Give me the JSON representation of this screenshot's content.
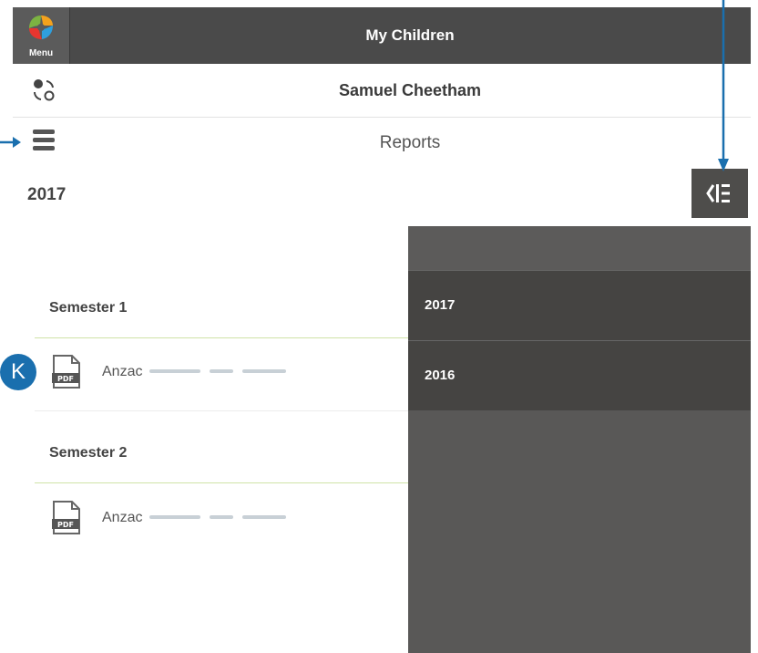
{
  "header": {
    "menu_label": "Menu",
    "title": "My Children"
  },
  "student": {
    "name": "Samuel Cheetham"
  },
  "page": {
    "title": "Reports"
  },
  "selected_year": "2017",
  "semesters": [
    {
      "title": "Semester 1",
      "reports": [
        {
          "name": "Anzac"
        }
      ]
    },
    {
      "title": "Semester 2",
      "reports": [
        {
          "name": "Anzac"
        }
      ]
    }
  ],
  "year_panel": {
    "years": [
      "2017",
      "2016"
    ]
  },
  "annotations": {
    "k": "K"
  },
  "icons": {
    "menu_logo": "app-logo-icon",
    "switch": "switch-child-icon",
    "hamburger": "hamburger-icon",
    "panel_toggle": "year-panel-toggle-icon",
    "pdf": "pdf-icon"
  },
  "colors": {
    "topbar": "#4a4a4a",
    "panel": "#595857",
    "panel_item": "#454442",
    "callout": "#1a6fae",
    "section_rule": "#cfe3a8"
  }
}
